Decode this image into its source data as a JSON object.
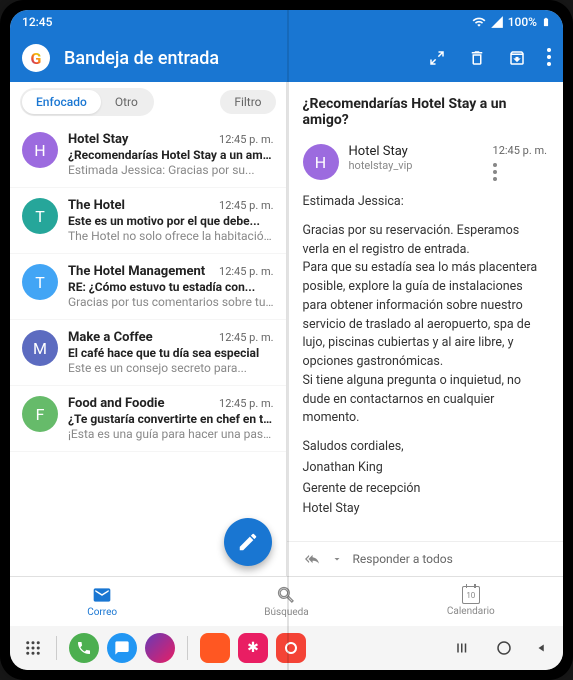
{
  "status": {
    "time": "12:45",
    "battery": "100%"
  },
  "header": {
    "title": "Bandeja de entrada"
  },
  "tabs": {
    "focused": "Enfocado",
    "other": "Otro",
    "filter": "Filtro"
  },
  "emails": [
    {
      "initial": "H",
      "color": "#9c6bdf",
      "sender": "Hotel Stay",
      "time": "12:45 p. m.",
      "subject": "¿Recomendarías Hotel Stay a un amigo?",
      "preview": "Estimada Jessica: Gracias por su..."
    },
    {
      "initial": "T",
      "color": "#26a69a",
      "sender": "The Hotel",
      "time": "12:45 p. m.",
      "subject": "Este es un motivo por el que debe...",
      "preview": "The Hotel no solo ofrece la habitación..."
    },
    {
      "initial": "T",
      "color": "#42a5f5",
      "sender": "The Hotel Management",
      "time": "12:45 p. m.",
      "subject": "RE: ¿Cómo estuvo tu estadía con...",
      "preview": "Gracias por tus comentarios sobre tu..."
    },
    {
      "initial": "M",
      "color": "#5c6bc0",
      "sender": "Make a Coffee",
      "time": "12:45 p. m.",
      "subject": "El café hace que tu día sea especial",
      "preview": "Este es un consejo secreto para..."
    },
    {
      "initial": "F",
      "color": "#66bb6a",
      "sender": "Food and Foodie",
      "time": "12:45 p. m.",
      "subject": "¿Te gustaría convertirte en chef en tu...",
      "preview": "¡Esta es una guía para hacer una pasta..."
    }
  ],
  "detail": {
    "subject": "¿Recomendarías Hotel Stay a un amigo?",
    "initial": "H",
    "avatarColor": "#9c6bdf",
    "senderName": "Hotel Stay",
    "senderEmail": "hotelstay_vip",
    "time": "12:45 p. m.",
    "greeting": "Estimada Jessica:",
    "body": "Gracias por su reservación. Esperamos verla en el registro de entrada.\nPara que su estadía sea lo más placentera posible, explore la guía de instalaciones para obtener información sobre nuestro servicio de traslado al aeropuerto, spa de lujo, piscinas cubiertas y al aire libre, y opciones gastronómicas.\nSi tiene alguna pregunta o inquietud, no dude en contactarnos en cualquier momento.",
    "sign1": "Saludos cordiales,",
    "sign2": "Jonathan King",
    "sign3": "Gerente de recepción",
    "sign4": "Hotel Stay",
    "replyAll": "Responder a todos"
  },
  "nav": {
    "mail": "Correo",
    "search": "Búsqueda",
    "calendar": "Calendario",
    "calDay": "10"
  }
}
